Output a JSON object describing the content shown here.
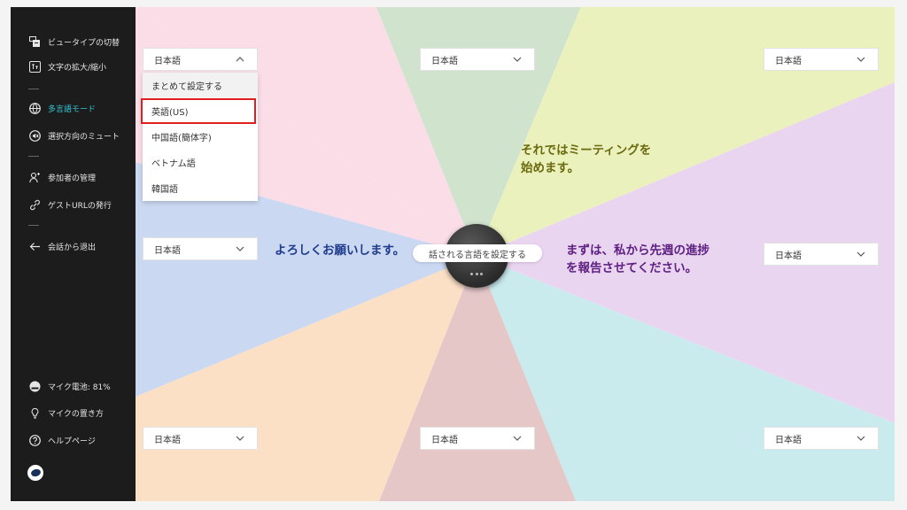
{
  "sidebar": {
    "top_items": [
      {
        "icon": "view-switch-icon",
        "label": "ビュータイプの切替"
      },
      {
        "icon": "text-zoom-icon",
        "label": "文字の拡大/縮小"
      }
    ],
    "mid_items": [
      {
        "icon": "multilingual-icon",
        "label": "多言語モード"
      },
      {
        "icon": "mute-direction-icon",
        "label": "選択方向のミュート"
      }
    ],
    "manage_items": [
      {
        "icon": "participants-icon",
        "label": "参加者の管理"
      },
      {
        "icon": "link-icon",
        "label": "ゲストURLの発行"
      }
    ],
    "exit": {
      "icon": "arrow-left-icon",
      "label": "会話から退出"
    },
    "bottom_items": [
      {
        "icon": "mic-battery-icon",
        "label": "マイク電池: 81%"
      },
      {
        "icon": "lightbulb-icon",
        "label": "マイクの置き方"
      },
      {
        "icon": "help-icon",
        "label": "ヘルプページ"
      }
    ],
    "active_color": "#35c4d3"
  },
  "selectors": [
    {
      "id": "top-left",
      "value": "日本語"
    },
    {
      "id": "top-center",
      "value": "日本語"
    },
    {
      "id": "top-right",
      "value": "日本語"
    },
    {
      "id": "mid-left",
      "value": "日本語"
    },
    {
      "id": "mid-right",
      "value": "日本語"
    },
    {
      "id": "bottom-left",
      "value": "日本語"
    },
    {
      "id": "bottom-center",
      "value": "日本語"
    },
    {
      "id": "bottom-right",
      "value": "日本語"
    }
  ],
  "dropdown": {
    "header": "まとめて設定する",
    "options": [
      "英語(US)",
      "中国語(簡体字)",
      "ベトナム語",
      "韓国語"
    ],
    "highlighted": "英語(US)"
  },
  "utterances": {
    "left": "よろしくお願いします。",
    "top_right": [
      "それではミーティングを",
      "始めます。"
    ],
    "right": [
      "まずは、私から先週の進捗",
      "を報告させてください。"
    ]
  },
  "hub": {
    "label": "話される言語を設定する"
  },
  "colors": {
    "sidebar_bg": "#1c1c1c",
    "highlight_border": "#e0201c",
    "left_text": "#1f3b8c",
    "top_right_text": "#6b6a0e",
    "right_text": "#5e2082"
  }
}
